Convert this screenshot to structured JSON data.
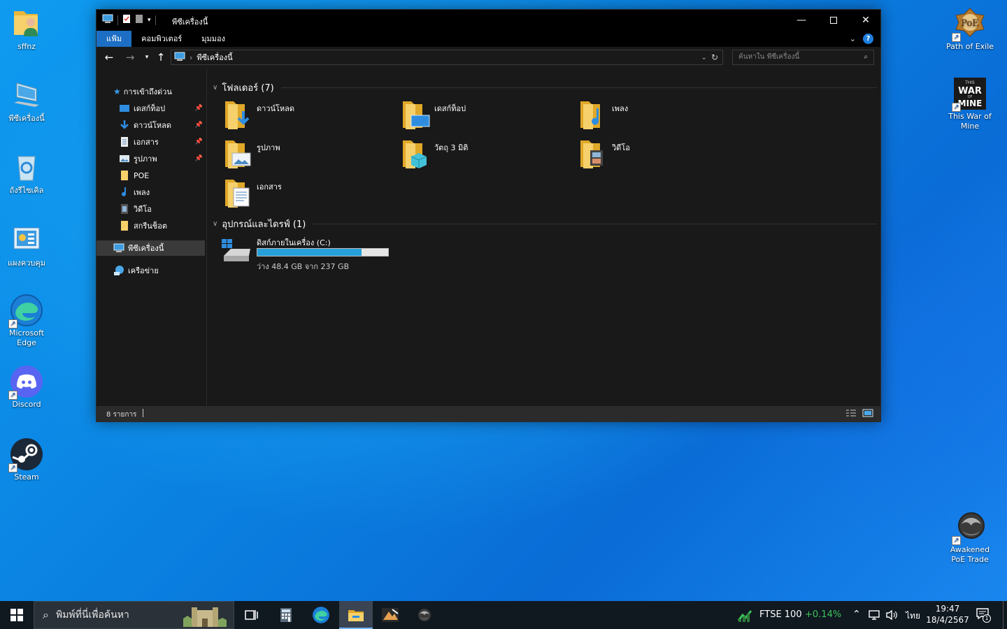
{
  "desktop": {
    "left_icons": [
      {
        "label": "sffnz",
        "icon": "user-folder-icon"
      },
      {
        "label": "พีซีเครื่องนี้",
        "icon": "this-pc-icon"
      },
      {
        "label": "ถังรีไซเคิล",
        "icon": "recycle-bin-icon"
      },
      {
        "label": "แผงควบคุม",
        "icon": "control-panel-icon"
      },
      {
        "label": "Microsoft Edge",
        "icon": "edge-icon"
      },
      {
        "label": "Discord",
        "icon": "discord-icon"
      },
      {
        "label": "Steam",
        "icon": "steam-icon"
      }
    ],
    "right_icons": [
      {
        "label": "Path of Exile",
        "icon": "poe-icon"
      },
      {
        "label": "This War of Mine",
        "icon": "this-war-of-mine-icon",
        "art_text": "THIS WAR OF MINE"
      },
      {
        "label": "Awakened PoE Trade",
        "icon": "awakened-poe-trade-icon"
      }
    ]
  },
  "explorer": {
    "title": "พีซีเครื่องนี้",
    "ribbon_tabs": [
      "แฟ้ม",
      "คอมพิวเตอร์",
      "มุมมอง"
    ],
    "active_tab": "แฟ้ม",
    "address_path": "พีซีเครื่องนี้",
    "search_placeholder": "ค้นหาใน พีซีเครื่องนี้",
    "nav": {
      "quick_access": "การเข้าถึงด่วน",
      "pinned": [
        {
          "label": "เดสก์ท็อป",
          "icon": "desktop-icon",
          "pinned": true
        },
        {
          "label": "ดาวน์โหลด",
          "icon": "downloads-icon",
          "pinned": true
        },
        {
          "label": "เอกสาร",
          "icon": "documents-icon",
          "pinned": true
        },
        {
          "label": "รูปภาพ",
          "icon": "pictures-icon",
          "pinned": true
        },
        {
          "label": "POE",
          "icon": "folder-icon",
          "pinned": false
        },
        {
          "label": "เพลง",
          "icon": "music-icon",
          "pinned": false
        },
        {
          "label": "วิดีโอ",
          "icon": "videos-icon",
          "pinned": false
        },
        {
          "label": "สกรีนช็อต",
          "icon": "folder-icon",
          "pinned": false
        }
      ],
      "this_pc": "พีซีเครื่องนี้",
      "network": "เครือข่าย"
    },
    "folders_header": "โฟลเดอร์ (7)",
    "folders": [
      {
        "label": "ดาวน์โหลด",
        "icon": "downloads-folder-icon"
      },
      {
        "label": "เดสก์ท็อป",
        "icon": "desktop-folder-icon"
      },
      {
        "label": "เพลง",
        "icon": "music-folder-icon"
      },
      {
        "label": "รูปภาพ",
        "icon": "pictures-folder-icon"
      },
      {
        "label": "วัตถุ 3 มิติ",
        "icon": "3d-objects-folder-icon"
      },
      {
        "label": "วิดีโอ",
        "icon": "videos-folder-icon"
      },
      {
        "label": "เอกสาร",
        "icon": "documents-folder-icon"
      }
    ],
    "devices_header": "อุปกรณ์และไดรฟ์ (1)",
    "drive": {
      "label": "ดิสก์ภายในเครื่อง (C:)",
      "free_text": "ว่าง 48.4 GB จาก 237 GB",
      "used_fraction": 0.796,
      "bar_color": "#26a0da"
    },
    "status": "8 รายการ"
  },
  "taskbar": {
    "search_placeholder": "พิมพ์ที่นี่เพื่อค้นหา",
    "apps": [
      "task-view-icon",
      "calculator-icon",
      "edge-icon",
      "file-explorer-icon",
      "game-icon",
      "awakened-poe-trade-icon"
    ],
    "ticker_name": "FTSE 100",
    "ticker_change": "+0.14%",
    "ticker_color": "#3cc35a",
    "language": "ไทย",
    "time": "19:47",
    "date": "18/4/2567",
    "notification_count": "1"
  },
  "colors": {
    "accent": "#1c6fc4",
    "window_bg": "#191919",
    "folder_yellow": "#f0c04a"
  }
}
